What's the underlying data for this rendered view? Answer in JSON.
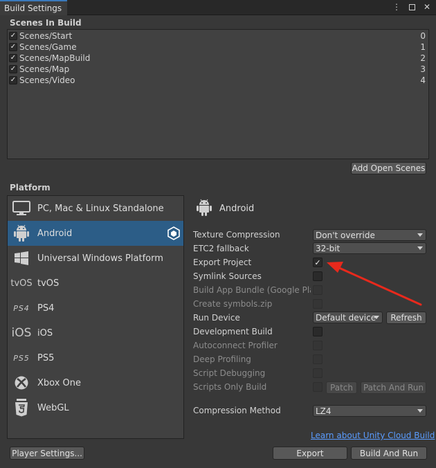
{
  "window": {
    "tab_title": "Build Settings",
    "menu_icon": "kebab-menu-icon",
    "maximize_icon": "maximize-icon",
    "close_icon": "close-icon"
  },
  "scenes": {
    "title": "Scenes In Build",
    "items": [
      {
        "name": "Scenes/Start",
        "index": "0",
        "checked": true
      },
      {
        "name": "Scenes/Game",
        "index": "1",
        "checked": true
      },
      {
        "name": "Scenes/MapBuild",
        "index": "2",
        "checked": true
      },
      {
        "name": "Scenes/Map",
        "index": "3",
        "checked": true
      },
      {
        "name": "Scenes/Video",
        "index": "4",
        "checked": true
      }
    ],
    "add_open_scenes_label": "Add Open Scenes"
  },
  "platform": {
    "title": "Platform",
    "items": [
      {
        "name": "PC, Mac & Linux Standalone",
        "icon": "monitor-icon"
      },
      {
        "name": "Android",
        "icon": "android-icon",
        "selected": true
      },
      {
        "name": "Universal Windows Platform",
        "icon": "windows-icon"
      },
      {
        "name": "tvOS",
        "icon_text": "tvOS"
      },
      {
        "name": "PS4",
        "icon_text": "PS4"
      },
      {
        "name": "iOS",
        "icon_text": "iOS"
      },
      {
        "name": "PS5",
        "icon_text": "PS5"
      },
      {
        "name": "Xbox One",
        "icon": "xbox-icon"
      },
      {
        "name": "WebGL",
        "icon": "html5-icon"
      }
    ]
  },
  "settings": {
    "platform_name": "Android",
    "texture_compression": {
      "label": "Texture Compression",
      "value": "Don't override"
    },
    "etc2_fallback": {
      "label": "ETC2 fallback",
      "value": "32-bit"
    },
    "export_project": {
      "label": "Export Project",
      "checked": true
    },
    "symlink_sources": {
      "label": "Symlink Sources"
    },
    "build_app_bundle": {
      "label": "Build App Bundle (Google Play"
    },
    "create_symbols": {
      "label": "Create symbols.zip"
    },
    "run_device": {
      "label": "Run Device",
      "value": "Default device",
      "refresh_label": "Refresh"
    },
    "development_build": {
      "label": "Development Build"
    },
    "autoconnect_profiler": {
      "label": "Autoconnect Profiler"
    },
    "deep_profiling": {
      "label": "Deep Profiling"
    },
    "script_debugging": {
      "label": "Script Debugging"
    },
    "scripts_only_build": {
      "label": "Scripts Only Build",
      "patch_label": "Patch",
      "patch_and_run_label": "Patch And Run"
    },
    "compression_method": {
      "label": "Compression Method",
      "value": "LZ4"
    }
  },
  "footer": {
    "cloud_build_link": "Learn about Unity Cloud Build",
    "player_settings_label": "Player Settings...",
    "export_label": "Export",
    "build_and_run_label": "Build And Run"
  },
  "colors": {
    "selected": "#2c5d87",
    "annotation_arrow": "#e8291c",
    "link": "#5a9cff"
  }
}
